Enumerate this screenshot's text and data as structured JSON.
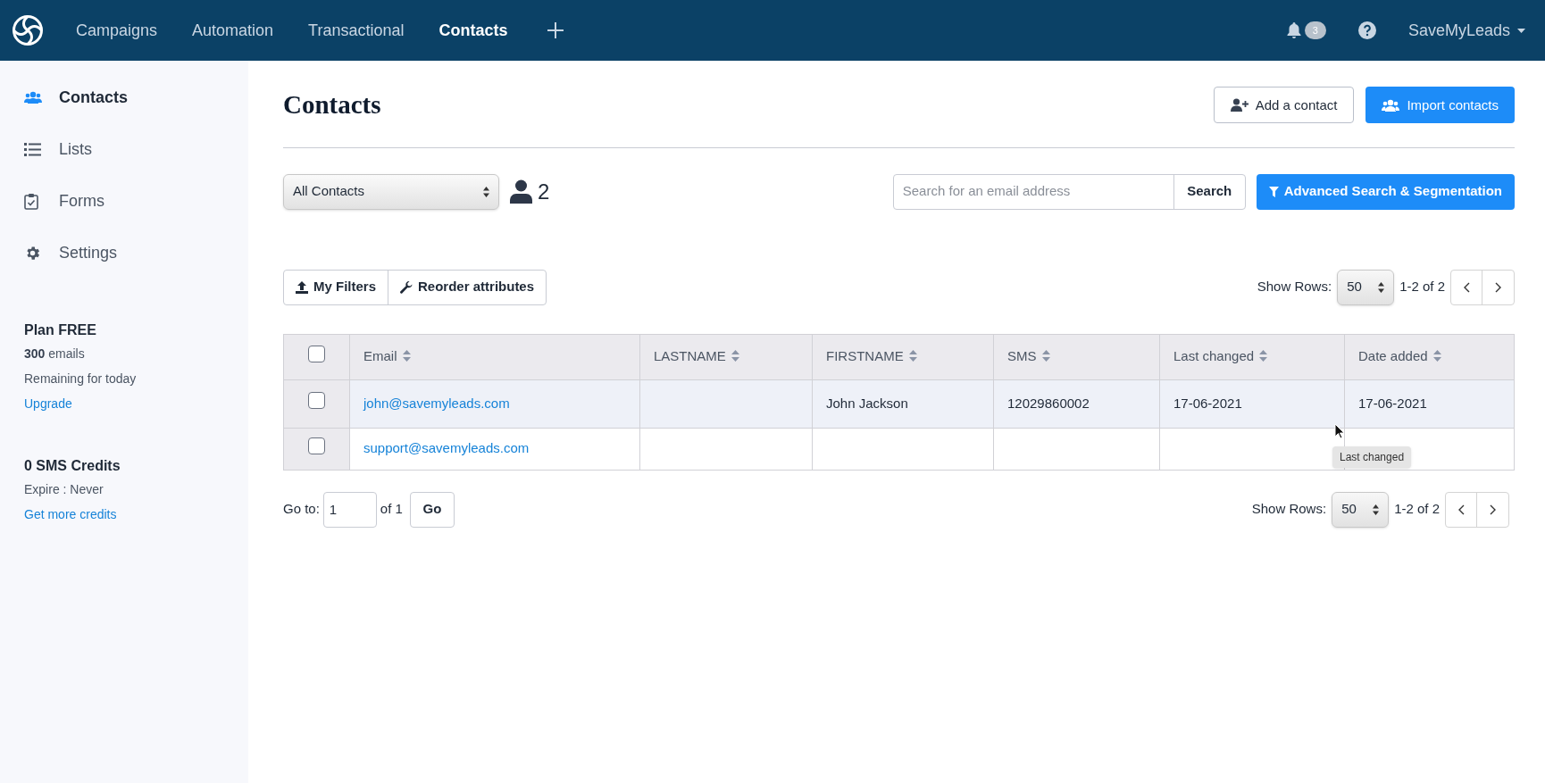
{
  "nav": {
    "items": [
      {
        "label": "Campaigns",
        "selected": false
      },
      {
        "label": "Automation",
        "selected": false
      },
      {
        "label": "Transactional",
        "selected": false
      },
      {
        "label": "Contacts",
        "selected": true
      }
    ],
    "notifications": "3",
    "user": "SaveMyLeads"
  },
  "sidebar": {
    "items": [
      {
        "label": "Contacts",
        "selected": true
      },
      {
        "label": "Lists",
        "selected": false
      },
      {
        "label": "Forms",
        "selected": false
      },
      {
        "label": "Settings",
        "selected": false
      }
    ],
    "plan": {
      "title": "Plan FREE",
      "emails": "**300** emails",
      "note": "Remaining for today",
      "link": "Upgrade"
    },
    "sms": {
      "title": "0 SMS Credits",
      "note": "Expire : Never",
      "link": "Get more credits"
    }
  },
  "page": {
    "title": "Contacts",
    "add_button": "Add a contact",
    "import_button": "Import contacts"
  },
  "toolbar": {
    "list_select": "All Contacts",
    "count": "2",
    "search": {
      "placeholder": "Search for an email address"
    },
    "search_button": "Search",
    "advanced_button": "Advanced Search & Segmentation"
  },
  "filters": {
    "my_filters": "My Filters",
    "reorder": "Reorder attributes",
    "show_rows_label": "Show Rows:",
    "rows": "50",
    "range": "1-2 of 2"
  },
  "table": {
    "header_checked": false,
    "columns": [
      "Email",
      "LASTNAME",
      "FIRSTNAME",
      "SMS",
      "Last changed",
      "Date added"
    ],
    "rows": [
      {
        "checked": false,
        "highlighted": true,
        "cells": [
          "john@savemyleads.com",
          "",
          "John Jackson",
          "12029860002",
          "17-06-2021",
          "17-06-2021"
        ]
      },
      {
        "checked": false,
        "highlighted": false,
        "cells": [
          "support@savemyleads.com",
          "",
          "",
          "",
          "",
          ""
        ]
      }
    ],
    "tooltip": "Last changed"
  },
  "footer": {
    "goto_label": "Go to:",
    "page": "1",
    "of": "of 1",
    "go_button": "Go",
    "show_rows_label": "Show Rows:",
    "rows": "50",
    "range": "1-2 of 2"
  }
}
